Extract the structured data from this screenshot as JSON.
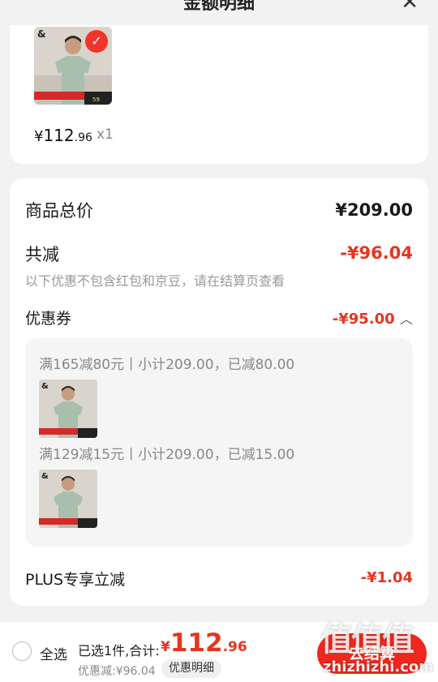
{
  "header": {
    "title": "金额明细",
    "close_icon": "close-icon"
  },
  "product": {
    "price_yen": "¥",
    "price_int": "112",
    "price_dec": ".96",
    "quantity": "x1",
    "image_icon": "polo-shirt-model-image",
    "selected": true,
    "thumb_tag_text": "59"
  },
  "summary": {
    "total_label": "商品总价",
    "total_value": "¥209.00",
    "reduce_label": "共减",
    "reduce_value": "-¥96.04",
    "note": "以下优惠不包含红包和京豆，请在结算页查看",
    "coupon_label": "优惠券",
    "coupon_value": "-¥95.00",
    "coupons": [
      {
        "text": "满165减80元丨小计209.00，已减80.00"
      },
      {
        "text": "满129减15元丨小计209.00，已减15.00"
      }
    ],
    "plus_label": "PLUS专享立减",
    "plus_value": "-¥1.04"
  },
  "footer": {
    "select_all": "全选",
    "selected_text": "已选1件,合计:",
    "total_yen": "¥",
    "total_int": "112",
    "total_dec": ".96",
    "discount_text": "优惠减:¥96.04",
    "detail_chip": "优惠明细",
    "checkout_label": "去结算"
  },
  "watermark": {
    "logo": "值值值",
    "url": "zhizhizhi.com"
  },
  "colors": {
    "accent": "#e8341f",
    "button": "#f0271c",
    "bg": "#f2f2f2"
  }
}
